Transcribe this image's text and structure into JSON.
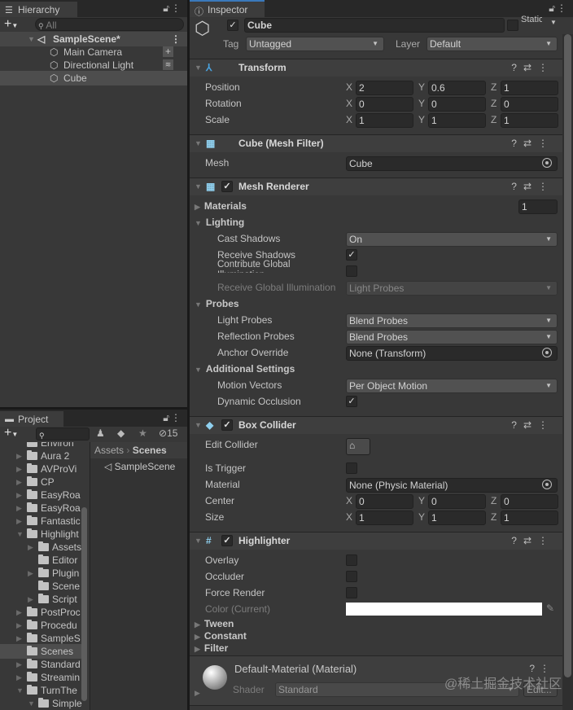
{
  "hierarchy": {
    "tab": "Hierarchy",
    "search_placeholder": "All",
    "scene": "SampleScene*",
    "items": [
      "Main Camera",
      "Directional Light",
      "Cube"
    ]
  },
  "project": {
    "tab": "Project",
    "hidden_count": "15",
    "breadcrumb": [
      "Assets",
      "Scenes"
    ],
    "assets": [
      "SampleScene"
    ],
    "tree": [
      {
        "label": "Environ",
        "depth": 0,
        "arrow": ""
      },
      {
        "label": "Aura 2",
        "depth": 0,
        "arrow": "▶"
      },
      {
        "label": "AVProVi",
        "depth": 0,
        "arrow": "▶"
      },
      {
        "label": "CP",
        "depth": 0,
        "arrow": "▶"
      },
      {
        "label": "EasyRoa",
        "depth": 0,
        "arrow": "▶"
      },
      {
        "label": "EasyRoa",
        "depth": 0,
        "arrow": "▶"
      },
      {
        "label": "Fantastic",
        "depth": 0,
        "arrow": "▶"
      },
      {
        "label": "Highlight",
        "depth": 0,
        "arrow": "▼"
      },
      {
        "label": "Assets",
        "depth": 1,
        "arrow": "▶"
      },
      {
        "label": "Editor",
        "depth": 1,
        "arrow": ""
      },
      {
        "label": "Plugin",
        "depth": 1,
        "arrow": "▶"
      },
      {
        "label": "Scene",
        "depth": 1,
        "arrow": ""
      },
      {
        "label": "Script",
        "depth": 1,
        "arrow": "▶"
      },
      {
        "label": "PostProc",
        "depth": 0,
        "arrow": "▶"
      },
      {
        "label": "Procedu",
        "depth": 0,
        "arrow": "▶"
      },
      {
        "label": "SampleS",
        "depth": 0,
        "arrow": "▶"
      },
      {
        "label": "Scenes",
        "depth": 0,
        "arrow": ""
      },
      {
        "label": "Standard",
        "depth": 0,
        "arrow": "▶"
      },
      {
        "label": "Streamin",
        "depth": 0,
        "arrow": "▶"
      },
      {
        "label": "TurnThe",
        "depth": 0,
        "arrow": "▼"
      },
      {
        "label": "Simple",
        "depth": 1,
        "arrow": "▼"
      }
    ]
  },
  "inspector": {
    "tab": "Inspector",
    "name": "Cube",
    "static_label": "Static",
    "tag_label": "Tag",
    "tag": "Untagged",
    "layer_label": "Layer",
    "layer": "Default",
    "transform": {
      "title": "Transform",
      "position_label": "Position",
      "position": [
        "2",
        "0.6",
        "1"
      ],
      "rotation_label": "Rotation",
      "rotation": [
        "0",
        "0",
        "0"
      ],
      "scale_label": "Scale",
      "scale": [
        "1",
        "1",
        "1"
      ]
    },
    "axes": [
      "X",
      "Y",
      "Z"
    ],
    "mesh_filter": {
      "title": "Cube (Mesh Filter)",
      "mesh_label": "Mesh",
      "mesh": "Cube"
    },
    "mesh_renderer": {
      "title": "Mesh Renderer",
      "materials": "Materials",
      "materials_count": "1",
      "lighting": "Lighting",
      "cast_shadows": "Cast Shadows",
      "cast_shadows_value": "On",
      "receive_shadows": "Receive Shadows",
      "contribute_gi": "Contribute Global Illumination",
      "receive_gi": "Receive Global Illumination",
      "receive_gi_value": "Light Probes",
      "probes": "Probes",
      "light_probes": "Light Probes",
      "light_probes_value": "Blend Probes",
      "reflection_probes": "Reflection Probes",
      "reflection_probes_value": "Blend Probes",
      "anchor_override": "Anchor Override",
      "anchor_override_value": "None (Transform)",
      "additional": "Additional Settings",
      "motion_vectors": "Motion Vectors",
      "motion_vectors_value": "Per Object Motion",
      "dynamic_occlusion": "Dynamic Occlusion"
    },
    "box_collider": {
      "title": "Box Collider",
      "edit_collider": "Edit Collider",
      "is_trigger": "Is Trigger",
      "material": "Material",
      "material_value": "None (Physic Material)",
      "center": "Center",
      "center_values": [
        "0",
        "0",
        "0"
      ],
      "size": "Size",
      "size_values": [
        "1",
        "1",
        "1"
      ]
    },
    "highlighter": {
      "title": "Highlighter",
      "overlay": "Overlay",
      "occluder": "Occluder",
      "force_render": "Force Render",
      "color": "Color (Current)",
      "color_value": "#ffffff",
      "tween": "Tween",
      "constant": "Constant",
      "filter": "Filter"
    },
    "material": {
      "title": "Default-Material (Material)",
      "shader_label": "Shader",
      "shader": "Standard",
      "edit": "Edit..."
    }
  },
  "watermark": "@稀土掘金技术社区"
}
